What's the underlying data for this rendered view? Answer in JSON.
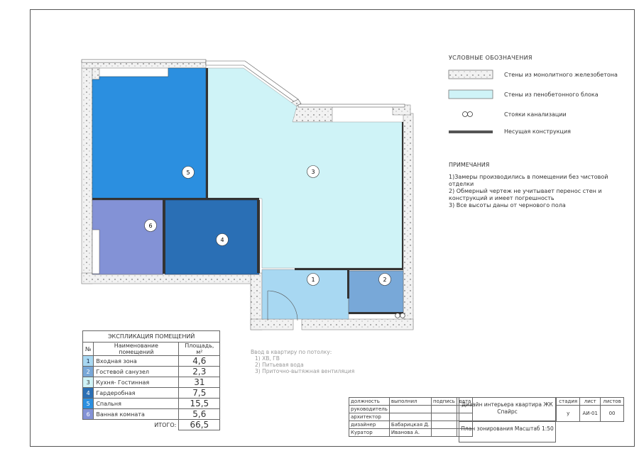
{
  "legend": {
    "title": "УСЛОВНЫЕ ОБОЗНАЧЕНИЯ",
    "items": [
      {
        "label": "Стены из монолитного железобетона",
        "icon": "concrete-wall-swatch"
      },
      {
        "label": "Стены из пенобетонного блока",
        "icon": "foam-block-wall-swatch"
      },
      {
        "label": "Стояки канализации",
        "icon": "sewer-riser-icon"
      },
      {
        "label": "Несущая конструкция",
        "icon": "load-bearing-line"
      }
    ]
  },
  "notes": {
    "title": "ПРИМЕЧАНИЯ",
    "items": [
      "1)Замеры производились в помещении без чистовой отделки",
      "2) Обмерный чертеж не учитывает перенос стен и конструкций и имеет погрешность",
      "3) Все высоты даны от чернового пола"
    ]
  },
  "rooms_on_plan": [
    "1",
    "2",
    "3",
    "4",
    "5",
    "6"
  ],
  "colors": {
    "entry": "#a8d8f2",
    "bathroom_guest": "#78a8d8",
    "kitchen_living": "#cff3f7",
    "wardrobe": "#2a6fb5",
    "bedroom": "#2b8fe0",
    "bathroom": "#8392d6"
  },
  "explication": {
    "title": "ЭКСПЛИКАЦИЯ ПОМЕЩЕНИЙ",
    "headers": [
      "№",
      "Наименование помещений",
      "Площадь, м²"
    ],
    "rows": [
      {
        "n": "1",
        "name": "Входная зона",
        "area": "4,6",
        "color": "#a8d8f2"
      },
      {
        "n": "2",
        "name": "Гостевой санузел",
        "area": "2,3",
        "color": "#78a8d8"
      },
      {
        "n": "3",
        "name": "Кухня- Гостинная",
        "area": "31",
        "color": "#cff3f7"
      },
      {
        "n": "4",
        "name": "Гардеробная",
        "area": "7,5",
        "color": "#2a6fb5"
      },
      {
        "n": "5",
        "name": "Спальня",
        "area": "15,5",
        "color": "#2b8fe0"
      },
      {
        "n": "6",
        "name": "Ванная комната",
        "area": "5,6",
        "color": "#8392d6"
      }
    ],
    "total_label": "ИТОГО:",
    "total": "66,5"
  },
  "entry_utilities": {
    "title": "Ввод в квартиру по потолку:",
    "items": [
      "1)    ХВ, ГВ",
      "2)    Питьевая вода",
      "3)    Приточно-вытяжная вентиляция"
    ]
  },
  "stamp": {
    "headers": [
      "должность",
      "выполнил",
      "подпись",
      "дата"
    ],
    "roles": [
      "руководитель",
      "архитектор",
      "дизайнер",
      "Куратор"
    ],
    "names": [
      "",
      "",
      "Бабарицкая Д.",
      "Иванова А."
    ],
    "project": "Дизайн интерьера квартира ЖК Спайрс",
    "sheet_title": "План зонирования Масштаб 1:50",
    "cols": [
      "стадия",
      "лист",
      "листов"
    ],
    "vals": [
      "у",
      "АИ-01",
      "00"
    ]
  }
}
